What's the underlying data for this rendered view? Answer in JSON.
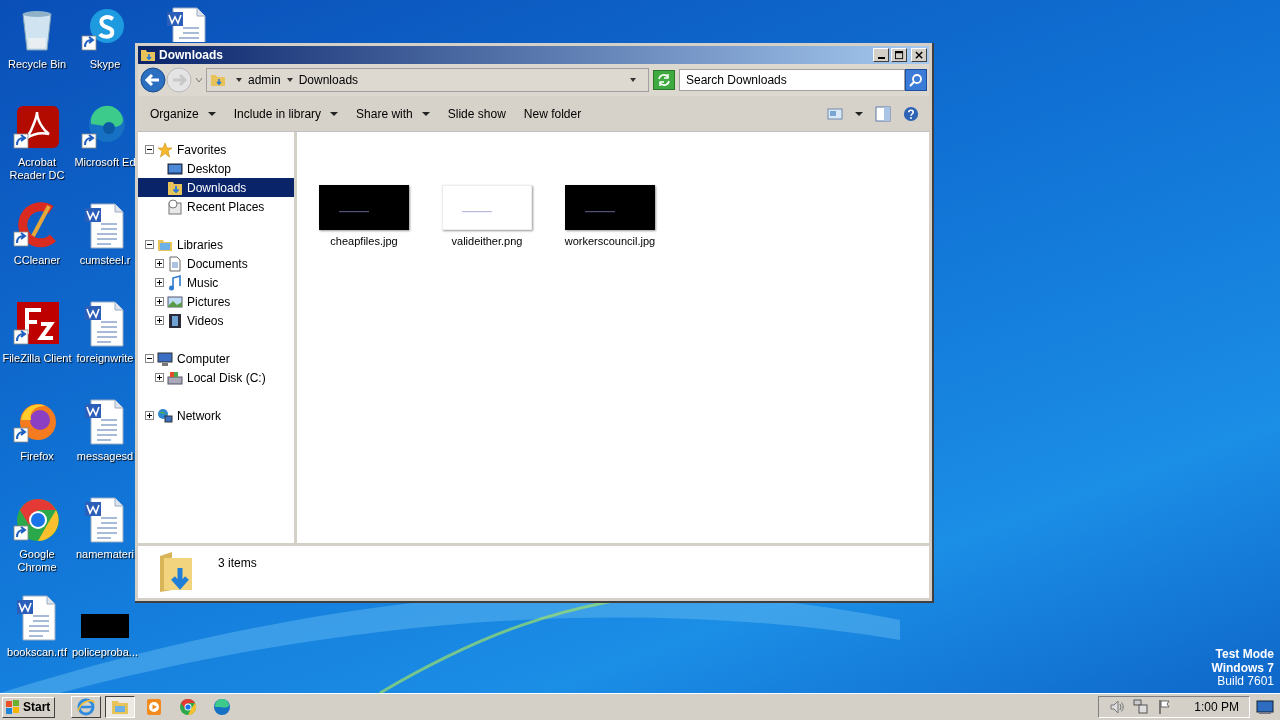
{
  "desktop": {
    "columns": [
      [
        {
          "label": "Recycle Bin",
          "kind": "recycle-bin",
          "shortcut": false
        },
        {
          "label": "Acrobat Reader DC",
          "kind": "acrobat",
          "shortcut": true
        },
        {
          "label": "CCleaner",
          "kind": "ccleaner",
          "shortcut": true
        },
        {
          "label": "FileZilla Client",
          "kind": "filezilla",
          "shortcut": true
        },
        {
          "label": "Firefox",
          "kind": "firefox",
          "shortcut": true
        },
        {
          "label": "Google Chrome",
          "kind": "chrome",
          "shortcut": true
        },
        {
          "label": "bookscan.rtf",
          "kind": "document",
          "shortcut": false
        }
      ],
      [
        {
          "label": "Skype",
          "kind": "skype",
          "shortcut": true
        },
        {
          "label": "Microsoft Ed",
          "kind": "edge",
          "shortcut": true
        },
        {
          "label": "cumsteel.r",
          "kind": "document",
          "shortcut": false
        },
        {
          "label": "foreignwrite",
          "kind": "document",
          "shortcut": false
        },
        {
          "label": "messagesd",
          "kind": "document",
          "shortcut": false
        },
        {
          "label": "namemateri",
          "kind": "document",
          "shortcut": false
        },
        {
          "label": "policeproba...",
          "shortcut": false
        }
      ],
      [
        {
          "kind": "document",
          "shortcut": false
        }
      ]
    ]
  },
  "window": {
    "title": "Downloads",
    "nav_buttons": [
      {
        "kind": "back",
        "disabled": false
      },
      {
        "kind": "forward",
        "disabled": true
      }
    ],
    "address": [
      "admin",
      "Downloads"
    ],
    "search": {
      "placeholder": "Search Downloads"
    },
    "toolbar": [
      {
        "label": "Organize",
        "dropdown": true
      },
      {
        "label": "Include in library",
        "dropdown": true
      },
      {
        "label": "Share with",
        "dropdown": true
      },
      {
        "label": "Slide show",
        "dropdown": false
      },
      {
        "label": "New folder",
        "dropdown": false
      }
    ],
    "navigation": [
      {
        "label": "Favorites",
        "kind": "star",
        "expanded": true,
        "selected": false,
        "children": [
          {
            "label": "Desktop",
            "kind": "desktop",
            "selected": false
          },
          {
            "label": "Downloads",
            "kind": "downloads",
            "selected": true
          },
          {
            "label": "Recent Places",
            "kind": "recent",
            "selected": false
          }
        ]
      },
      {
        "label": "Libraries",
        "kind": "library",
        "expanded": true,
        "selected": false,
        "children": [
          {
            "label": "Documents",
            "kind": "documents",
            "expanded": false,
            "selected": false
          },
          {
            "label": "Music",
            "kind": "music",
            "expanded": false,
            "selected": false
          },
          {
            "label": "Pictures",
            "kind": "pictures",
            "expanded": false,
            "selected": false
          },
          {
            "label": "Videos",
            "kind": "videos",
            "expanded": false,
            "selected": false
          }
        ]
      },
      {
        "label": "Computer",
        "kind": "computer",
        "expanded": true,
        "selected": false,
        "children": [
          {
            "label": "Local Disk (C:)",
            "kind": "disk",
            "expanded": false,
            "selected": false
          }
        ]
      },
      {
        "label": "Network",
        "kind": "network",
        "expanded": false,
        "selected": false
      }
    ],
    "files": [
      {
        "name": "cheapfiles.jpg",
        "color": "#000000"
      },
      {
        "name": "valideither.png",
        "color": "#ffffff"
      },
      {
        "name": "workerscouncil.jpg",
        "color": "#000000"
      }
    ],
    "status": "3 items"
  },
  "system_note": [
    "Test Mode",
    "Windows 7",
    "Build 7601"
  ],
  "taskbar": {
    "start": "Start",
    "apps": [
      {
        "kind": "ie",
        "selected": false
      },
      {
        "kind": "explorer",
        "selected": true
      },
      {
        "kind": "media",
        "selected": false
      },
      {
        "kind": "chrome",
        "selected": false
      },
      {
        "kind": "edge",
        "selected": false
      }
    ],
    "clock": "1:00 PM"
  }
}
